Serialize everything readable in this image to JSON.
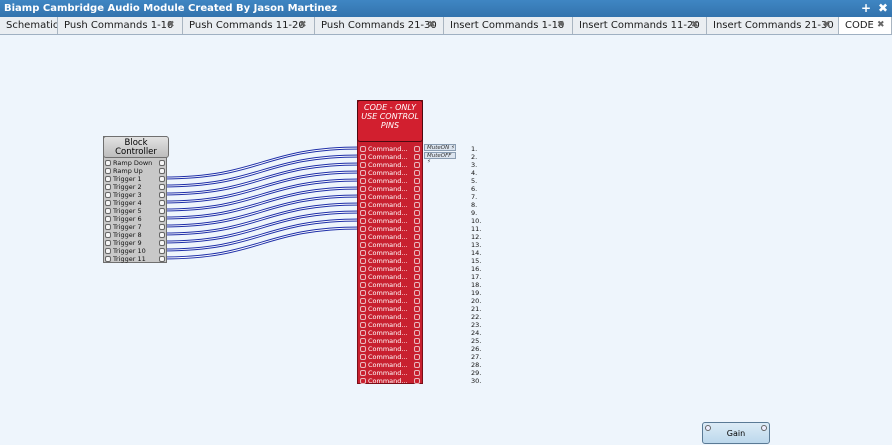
{
  "window": {
    "title": "Biamp Cambridge Audio Module Created By Jason Martinez",
    "add_icon": "+",
    "close_icon": "✖"
  },
  "tabs": [
    {
      "label": "Schematic",
      "closable": false
    },
    {
      "label": "Push Commands 1-10",
      "closable": true
    },
    {
      "label": "Push Commands 11-20",
      "closable": true
    },
    {
      "label": "Push Commands 21-30",
      "closable": true
    },
    {
      "label": "Insert Commands 1-10",
      "closable": true
    },
    {
      "label": "Insert Commands 11-20",
      "closable": true
    },
    {
      "label": "Insert Commands 21-30",
      "closable": true
    },
    {
      "label": "CODE",
      "closable": true,
      "active": true
    }
  ],
  "block_controller": {
    "title": "Block Controller",
    "pins": [
      "Ramp Down",
      "Ramp Up",
      "Trigger 1",
      "Trigger 2",
      "Trigger 3",
      "Trigger 4",
      "Trigger 5",
      "Trigger 6",
      "Trigger 7",
      "Trigger 8",
      "Trigger 9",
      "Trigger 10",
      "Trigger 11"
    ]
  },
  "code_block": {
    "title": "CODE - ONLY USE CONTROL PINS",
    "row_label": "Command...",
    "row_count": 30,
    "flags": [
      "MuteON",
      "MuteOFF"
    ]
  },
  "numbers": [
    "1.",
    "2.",
    "3.",
    "4.",
    "5.",
    "6.",
    "7.",
    "8.",
    "9.",
    "10.",
    "11.",
    "12.",
    "13.",
    "14.",
    "15.",
    "16.",
    "17.",
    "18.",
    "19.",
    "20.",
    "21.",
    "22.",
    "23.",
    "24.",
    "25.",
    "26.",
    "27.",
    "28.",
    "29.",
    "30."
  ],
  "gain_block": {
    "label": "Gain"
  },
  "colors": {
    "titlebar": "#3373ad",
    "code_block": "#c8202f",
    "wire": "#1e2fa8",
    "canvas": "#eef5fc"
  }
}
